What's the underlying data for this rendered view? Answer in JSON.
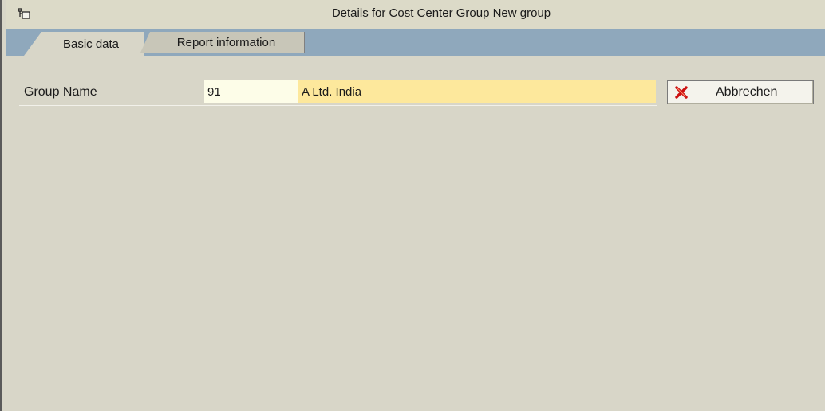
{
  "window": {
    "title": "Details for Cost Center Group New group",
    "title_icon": "folder-tree-icon"
  },
  "tabs": [
    {
      "label": "Basic data",
      "active": true
    },
    {
      "label": "Report information",
      "active": false
    }
  ],
  "form": {
    "group_name_label": "Group Name",
    "group_id_value": "91",
    "group_description_value": "A Ltd. India"
  },
  "actions": {
    "cancel_label": "Abbrechen",
    "cancel_icon": "cancel-x-icon"
  },
  "colors": {
    "content_background": "#d8d6c8",
    "tab_strip": "#8fa8bc",
    "required_field": "#fde89c",
    "cancel_icon": "#cc1010"
  }
}
